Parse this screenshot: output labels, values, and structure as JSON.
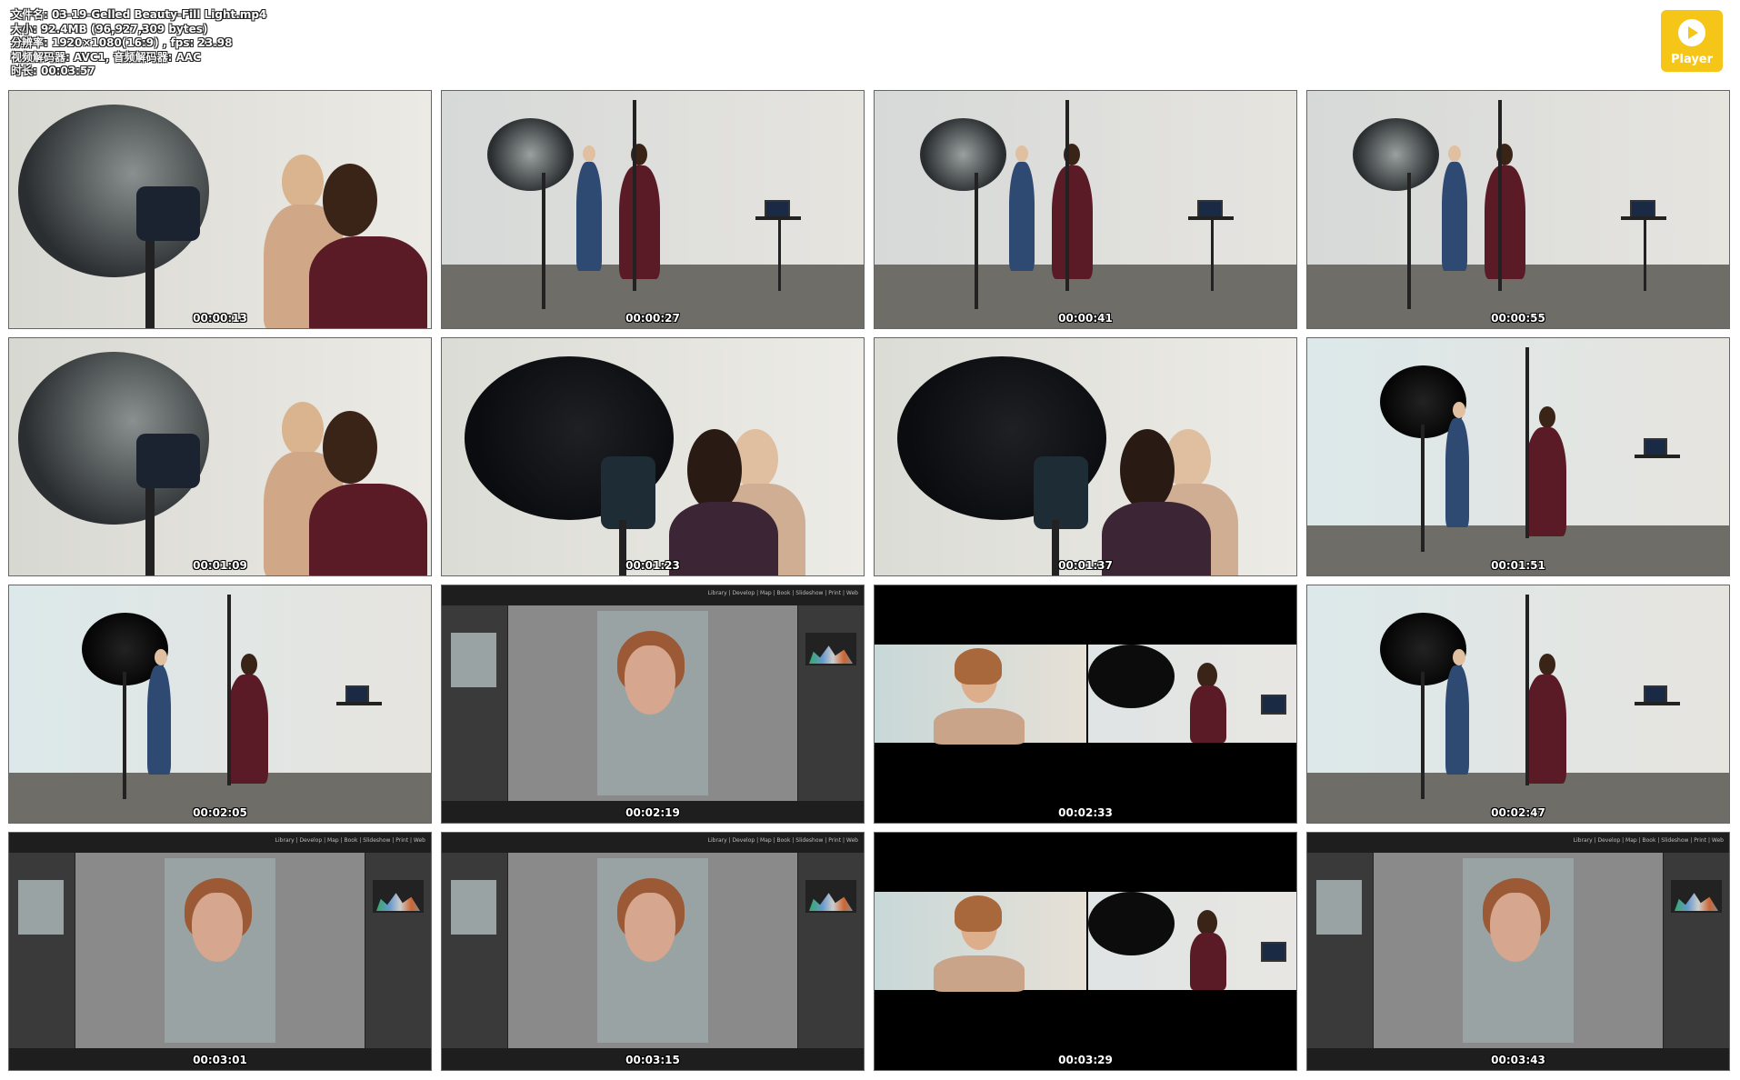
{
  "info": {
    "filename": "文件名: 03-19-Gelled Beauty-Fill Light.mp4",
    "size": "大小: 92.4MB (96,927,309 bytes)",
    "resolution": "分辨率: 1920×1080(16:9) , fps: 23.98",
    "codec": "视频解码器: AVC1, 音频解码器: AAC",
    "duration": "时长: 00:03:57"
  },
  "player": {
    "label": "Player",
    "icon": "play-icon",
    "color": "#f5c518"
  },
  "thumbnails": [
    {
      "time": "00:00:13",
      "scene": "closeup-umbrella"
    },
    {
      "time": "00:00:27",
      "scene": "studio-wide"
    },
    {
      "time": "00:00:41",
      "scene": "studio-wide"
    },
    {
      "time": "00:00:55",
      "scene": "studio-wide"
    },
    {
      "time": "00:01:09",
      "scene": "closeup-umbrella"
    },
    {
      "time": "00:01:23",
      "scene": "closeup-black-umbrella"
    },
    {
      "time": "00:01:37",
      "scene": "closeup-black-umbrella"
    },
    {
      "time": "00:01:51",
      "scene": "studio-black-umbrella"
    },
    {
      "time": "00:02:05",
      "scene": "studio-black-umbrella"
    },
    {
      "time": "00:02:19",
      "scene": "lightroom"
    },
    {
      "time": "00:02:33",
      "scene": "split"
    },
    {
      "time": "00:02:47",
      "scene": "studio-black-umbrella"
    },
    {
      "time": "00:03:01",
      "scene": "lightroom"
    },
    {
      "time": "00:03:15",
      "scene": "lightroom"
    },
    {
      "time": "00:03:29",
      "scene": "split"
    },
    {
      "time": "00:03:43",
      "scene": "lightroom"
    }
  ],
  "lightroom": {
    "nav": "Library | Develop | Map | Book | Slideshow | Print | Web"
  }
}
